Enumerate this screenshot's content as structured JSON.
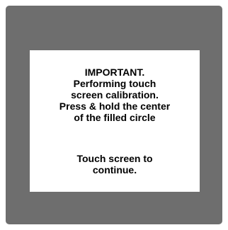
{
  "colors": {
    "screen_background": "#6e6e6e",
    "dialog_background": "#ffffff",
    "text": "#000000"
  },
  "calibration_dialog": {
    "message_lines": [
      "IMPORTANT.",
      "Performing touch",
      "screen calibration.",
      "Press & hold the center",
      "of the filled circle"
    ],
    "continue_lines": [
      "Touch screen to",
      "continue."
    ]
  }
}
